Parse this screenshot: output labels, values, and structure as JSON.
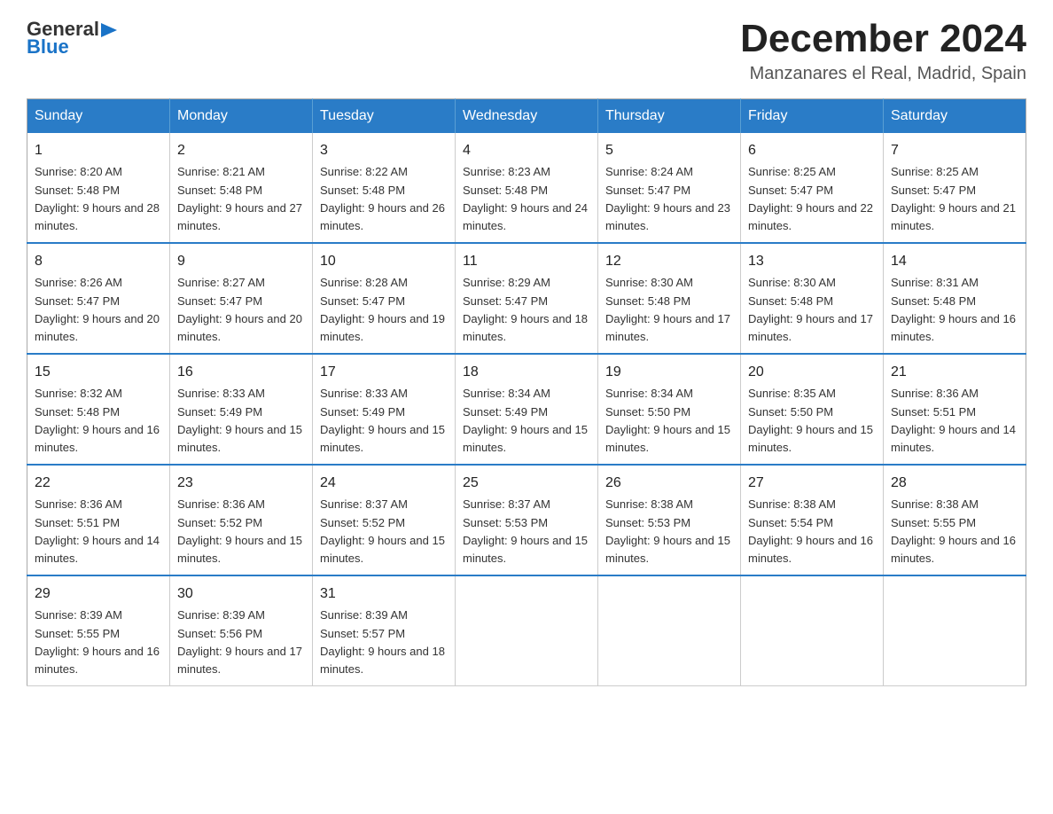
{
  "header": {
    "logo_general": "General",
    "logo_blue": "Blue",
    "month_title": "December 2024",
    "location": "Manzanares el Real, Madrid, Spain"
  },
  "days_of_week": [
    "Sunday",
    "Monday",
    "Tuesday",
    "Wednesday",
    "Thursday",
    "Friday",
    "Saturday"
  ],
  "weeks": [
    [
      {
        "day": "1",
        "sunrise": "8:20 AM",
        "sunset": "5:48 PM",
        "daylight": "9 hours and 28 minutes."
      },
      {
        "day": "2",
        "sunrise": "8:21 AM",
        "sunset": "5:48 PM",
        "daylight": "9 hours and 27 minutes."
      },
      {
        "day": "3",
        "sunrise": "8:22 AM",
        "sunset": "5:48 PM",
        "daylight": "9 hours and 26 minutes."
      },
      {
        "day": "4",
        "sunrise": "8:23 AM",
        "sunset": "5:48 PM",
        "daylight": "9 hours and 24 minutes."
      },
      {
        "day": "5",
        "sunrise": "8:24 AM",
        "sunset": "5:47 PM",
        "daylight": "9 hours and 23 minutes."
      },
      {
        "day": "6",
        "sunrise": "8:25 AM",
        "sunset": "5:47 PM",
        "daylight": "9 hours and 22 minutes."
      },
      {
        "day": "7",
        "sunrise": "8:25 AM",
        "sunset": "5:47 PM",
        "daylight": "9 hours and 21 minutes."
      }
    ],
    [
      {
        "day": "8",
        "sunrise": "8:26 AM",
        "sunset": "5:47 PM",
        "daylight": "9 hours and 20 minutes."
      },
      {
        "day": "9",
        "sunrise": "8:27 AM",
        "sunset": "5:47 PM",
        "daylight": "9 hours and 20 minutes."
      },
      {
        "day": "10",
        "sunrise": "8:28 AM",
        "sunset": "5:47 PM",
        "daylight": "9 hours and 19 minutes."
      },
      {
        "day": "11",
        "sunrise": "8:29 AM",
        "sunset": "5:47 PM",
        "daylight": "9 hours and 18 minutes."
      },
      {
        "day": "12",
        "sunrise": "8:30 AM",
        "sunset": "5:48 PM",
        "daylight": "9 hours and 17 minutes."
      },
      {
        "day": "13",
        "sunrise": "8:30 AM",
        "sunset": "5:48 PM",
        "daylight": "9 hours and 17 minutes."
      },
      {
        "day": "14",
        "sunrise": "8:31 AM",
        "sunset": "5:48 PM",
        "daylight": "9 hours and 16 minutes."
      }
    ],
    [
      {
        "day": "15",
        "sunrise": "8:32 AM",
        "sunset": "5:48 PM",
        "daylight": "9 hours and 16 minutes."
      },
      {
        "day": "16",
        "sunrise": "8:33 AM",
        "sunset": "5:49 PM",
        "daylight": "9 hours and 15 minutes."
      },
      {
        "day": "17",
        "sunrise": "8:33 AM",
        "sunset": "5:49 PM",
        "daylight": "9 hours and 15 minutes."
      },
      {
        "day": "18",
        "sunrise": "8:34 AM",
        "sunset": "5:49 PM",
        "daylight": "9 hours and 15 minutes."
      },
      {
        "day": "19",
        "sunrise": "8:34 AM",
        "sunset": "5:50 PM",
        "daylight": "9 hours and 15 minutes."
      },
      {
        "day": "20",
        "sunrise": "8:35 AM",
        "sunset": "5:50 PM",
        "daylight": "9 hours and 15 minutes."
      },
      {
        "day": "21",
        "sunrise": "8:36 AM",
        "sunset": "5:51 PM",
        "daylight": "9 hours and 14 minutes."
      }
    ],
    [
      {
        "day": "22",
        "sunrise": "8:36 AM",
        "sunset": "5:51 PM",
        "daylight": "9 hours and 14 minutes."
      },
      {
        "day": "23",
        "sunrise": "8:36 AM",
        "sunset": "5:52 PM",
        "daylight": "9 hours and 15 minutes."
      },
      {
        "day": "24",
        "sunrise": "8:37 AM",
        "sunset": "5:52 PM",
        "daylight": "9 hours and 15 minutes."
      },
      {
        "day": "25",
        "sunrise": "8:37 AM",
        "sunset": "5:53 PM",
        "daylight": "9 hours and 15 minutes."
      },
      {
        "day": "26",
        "sunrise": "8:38 AM",
        "sunset": "5:53 PM",
        "daylight": "9 hours and 15 minutes."
      },
      {
        "day": "27",
        "sunrise": "8:38 AM",
        "sunset": "5:54 PM",
        "daylight": "9 hours and 16 minutes."
      },
      {
        "day": "28",
        "sunrise": "8:38 AM",
        "sunset": "5:55 PM",
        "daylight": "9 hours and 16 minutes."
      }
    ],
    [
      {
        "day": "29",
        "sunrise": "8:39 AM",
        "sunset": "5:55 PM",
        "daylight": "9 hours and 16 minutes."
      },
      {
        "day": "30",
        "sunrise": "8:39 AM",
        "sunset": "5:56 PM",
        "daylight": "9 hours and 17 minutes."
      },
      {
        "day": "31",
        "sunrise": "8:39 AM",
        "sunset": "5:57 PM",
        "daylight": "9 hours and 18 minutes."
      },
      null,
      null,
      null,
      null
    ]
  ],
  "labels": {
    "sunrise": "Sunrise: ",
    "sunset": "Sunset: ",
    "daylight": "Daylight: "
  }
}
